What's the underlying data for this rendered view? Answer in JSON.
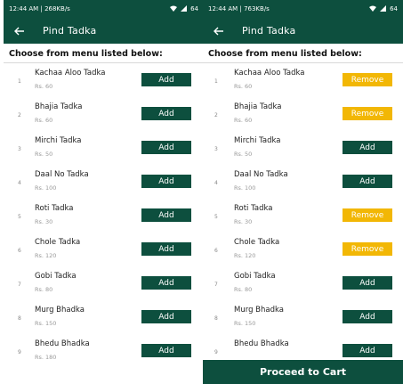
{
  "left": {
    "status": {
      "time": "12:44 AM",
      "speed": "268KB/s",
      "battery": "64"
    },
    "appbar": {
      "title": "Pind Tadka",
      "back_icon": "arrow-left-icon"
    },
    "subtitle": "Choose from menu listed below:",
    "items": [
      {
        "index": "1",
        "name": "Kachaa Aloo Tadka",
        "price": "Rs. 60",
        "button": "Add"
      },
      {
        "index": "2",
        "name": "Bhajia Tadka",
        "price": "Rs. 60",
        "button": "Add"
      },
      {
        "index": "3",
        "name": "Mirchi Tadka",
        "price": "Rs. 50",
        "button": "Add"
      },
      {
        "index": "4",
        "name": "Daal No Tadka",
        "price": "Rs. 100",
        "button": "Add"
      },
      {
        "index": "5",
        "name": "Roti Tadka",
        "price": "Rs. 30",
        "button": "Add"
      },
      {
        "index": "6",
        "name": "Chole Tadka",
        "price": "Rs. 120",
        "button": "Add"
      },
      {
        "index": "7",
        "name": "Gobi Tadka",
        "price": "Rs. 80",
        "button": "Add"
      },
      {
        "index": "8",
        "name": "Murg Bhadka",
        "price": "Rs. 150",
        "button": "Add"
      },
      {
        "index": "9",
        "name": "Bhedu Bhadka",
        "price": "Rs. 180",
        "button": "Add"
      }
    ]
  },
  "right": {
    "status": {
      "time": "12:44 AM",
      "speed": "763KB/s",
      "battery": "64"
    },
    "appbar": {
      "title": "Pind Tadka",
      "back_icon": "arrow-left-icon"
    },
    "subtitle": "Choose from menu listed below:",
    "items": [
      {
        "index": "1",
        "name": "Kachaa Aloo Tadka",
        "price": "Rs. 60",
        "button": "Remove",
        "state": "remove"
      },
      {
        "index": "2",
        "name": "Bhajia Tadka",
        "price": "Rs. 60",
        "button": "Remove",
        "state": "remove"
      },
      {
        "index": "3",
        "name": "Mirchi Tadka",
        "price": "Rs. 50",
        "button": "Add",
        "state": "add"
      },
      {
        "index": "4",
        "name": "Daal No Tadka",
        "price": "Rs. 100",
        "button": "Add",
        "state": "add"
      },
      {
        "index": "5",
        "name": "Roti Tadka",
        "price": "Rs. 30",
        "button": "Remove",
        "state": "remove"
      },
      {
        "index": "6",
        "name": "Chole Tadka",
        "price": "Rs. 120",
        "button": "Remove",
        "state": "remove"
      },
      {
        "index": "7",
        "name": "Gobi Tadka",
        "price": "Rs. 80",
        "button": "Add",
        "state": "add"
      },
      {
        "index": "8",
        "name": "Murg Bhadka",
        "price": "Rs. 150",
        "button": "Add",
        "state": "add"
      },
      {
        "index": "9",
        "name": "Bhedu Bhadka",
        "price": "",
        "button": "Add",
        "state": "add"
      }
    ],
    "proceed_label": "Proceed to Cart"
  },
  "colors": {
    "primary": "#0d4f3e",
    "remove": "#f2b705"
  }
}
